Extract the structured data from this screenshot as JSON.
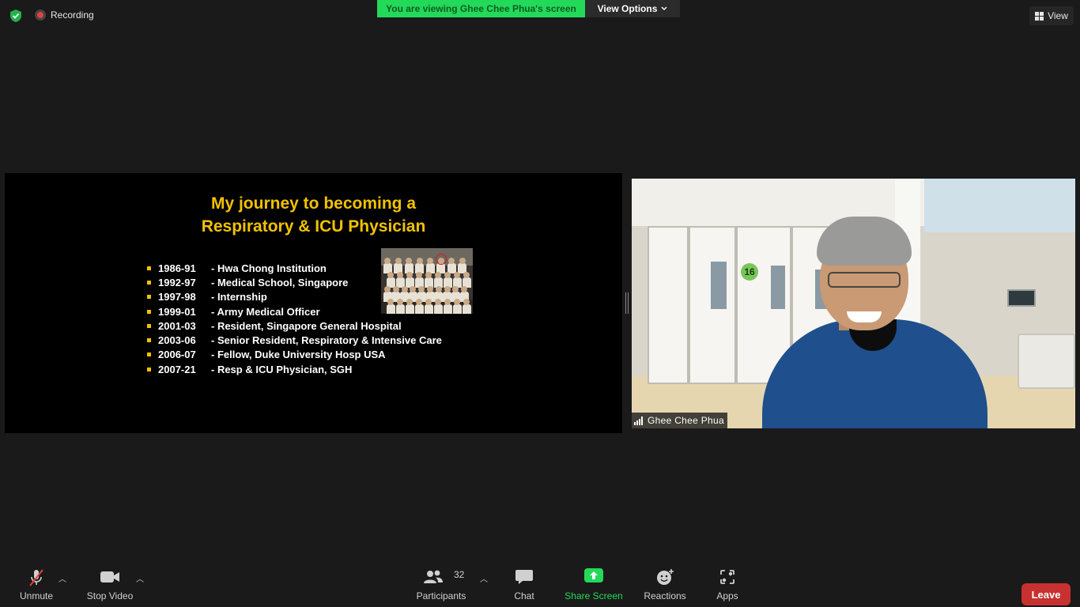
{
  "top_bar": {
    "recording_label": "Recording",
    "viewing_banner": "You are viewing Ghee Chee Phua's screen",
    "view_options_label": "View Options",
    "view_label": "View"
  },
  "slide": {
    "title_line1": "My journey to becoming a",
    "title_line2": "Respiratory & ICU Physician",
    "items": [
      {
        "years": "1986-91",
        "text": "- Hwa Chong Institution"
      },
      {
        "years": "1992-97",
        "text": "- Medical School, Singapore"
      },
      {
        "years": "1997-98",
        "text": "- Internship"
      },
      {
        "years": "1999-01",
        "text": "- Army Medical Officer"
      },
      {
        "years": "2001-03",
        "text": "- Resident, Singapore General Hospital"
      },
      {
        "years": "2003-06",
        "text": "- Senior Resident, Respiratory & Intensive Care"
      },
      {
        "years": "2006-07",
        "text": "- Fellow, Duke University Hosp USA"
      },
      {
        "years": "2007-21",
        "text": "- Resp & ICU Physician, SGH"
      }
    ]
  },
  "video": {
    "participant_name": "Ghee Chee Phua",
    "room_sign": "16"
  },
  "toolbar": {
    "unmute_label": "Unmute",
    "stop_video_label": "Stop Video",
    "participants_label": "Participants",
    "participants_count": "32",
    "chat_label": "Chat",
    "share_screen_label": "Share Screen",
    "reactions_label": "Reactions",
    "apps_label": "Apps",
    "leave_label": "Leave"
  },
  "colors": {
    "share_green": "#23d959",
    "slide_title": "#f2c200",
    "leave_red": "#c7312f"
  }
}
